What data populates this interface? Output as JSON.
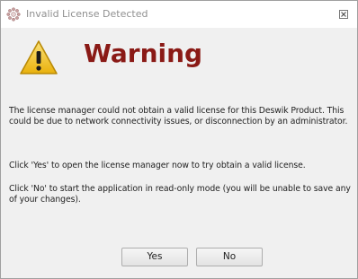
{
  "window": {
    "title": "Invalid License Detected",
    "close_symbol": "⊠",
    "icons": {
      "app": "deswik-app-icon",
      "close": "close-icon",
      "warning": "warning-triangle-icon"
    },
    "colors": {
      "heading": "#8a1a16",
      "warning_fill": "#f2c318",
      "background": "#f0f0f0"
    }
  },
  "dialog": {
    "heading": "Warning",
    "message_1": "The license manager could not obtain a valid license for this Deswik Product.  This could be due to network connectivity issues, or disconnection by an administrator.",
    "message_2": "Click 'Yes' to open the license manager now to try obtain a valid license.",
    "message_3": "Click 'No' to start the application in read-only mode (you will be unable to save any of your changes).",
    "yes_label": "Yes",
    "no_label": "No"
  }
}
